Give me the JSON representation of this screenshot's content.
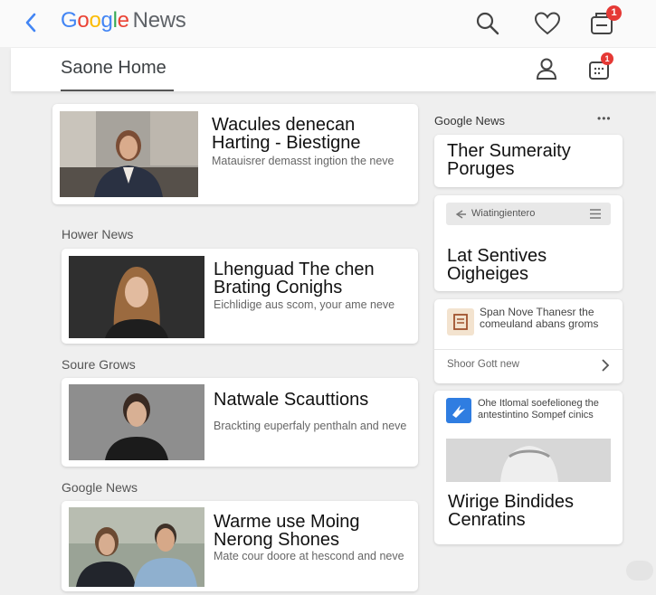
{
  "header": {
    "logo_google": [
      "G",
      "o",
      "o",
      "g",
      "l",
      "e"
    ],
    "logo_news": "News",
    "notification_count": "1",
    "sub_badge": "1"
  },
  "subnav": {
    "title": "Saone Home"
  },
  "main": {
    "articles": [
      {
        "headline": "Wacules denecan Harting - Biestigne",
        "snippet": "Matauisrer demasst ingtion the neve"
      },
      {
        "headline": "Lhenguad The chen Brating Conighs",
        "snippet": "Eichlidige aus scom, your ame neve"
      },
      {
        "headline": "Natwale Scauttions",
        "snippet": "Brackting euperfaly penthaln and neve"
      },
      {
        "headline": "Warme use Moing Nerong Shones",
        "snippet": "Mate cour doore at hescond and neve"
      }
    ],
    "sections": [
      "Hower News",
      "Soure Grows",
      "Google News"
    ]
  },
  "side": {
    "header": "Google News",
    "more": "•••",
    "card1": {
      "headline": "Ther Sumeraity Poruges"
    },
    "card2": {
      "search_text": "Wiatingientero",
      "headline": "Lat Sentives Oigheiges"
    },
    "card3": {
      "text": "Span Nove Thanesr the comeuland abans groms",
      "link": "Shoor Gott new"
    },
    "card4": {
      "text": "Ohe Itlomal soefelioneg the antestintino Sompef cinics",
      "headline": "Wirige Bindides Cenratins"
    }
  }
}
